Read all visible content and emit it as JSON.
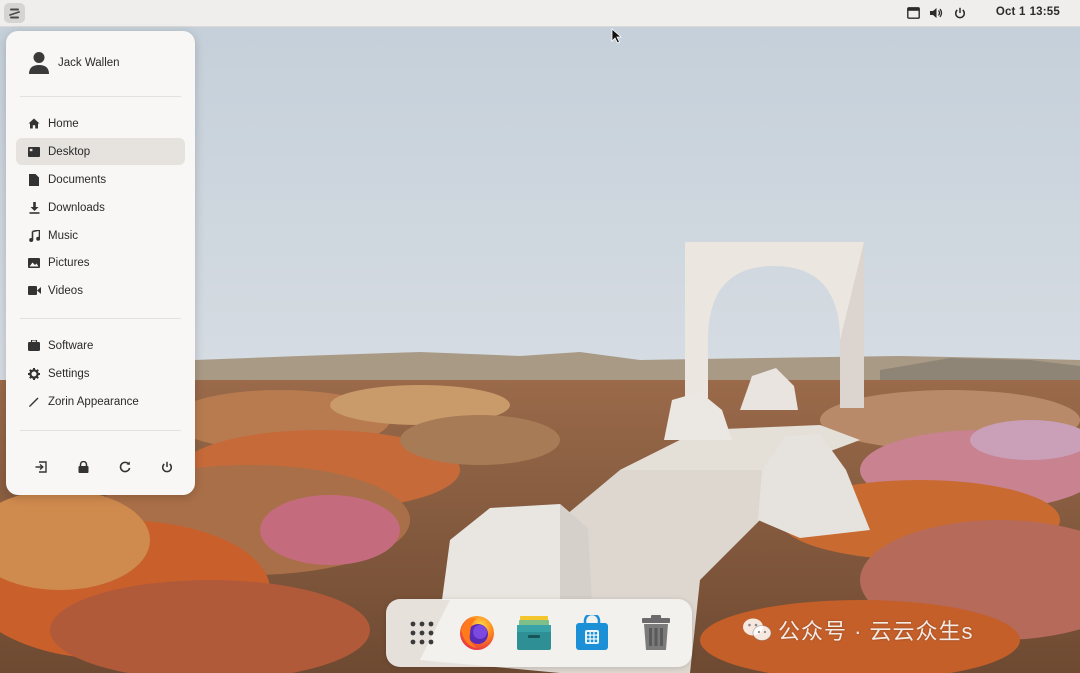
{
  "top_bar": {
    "menu_button_icon": "zorin-logo-icon",
    "tray_icons": [
      "display-icon",
      "volume-icon",
      "power-icon"
    ],
    "date": "Oct 1",
    "time": "13:55"
  },
  "places_menu": {
    "user_name": "Jack Wallen",
    "places": [
      {
        "label": "Home",
        "icon": "home-icon"
      },
      {
        "label": "Desktop",
        "icon": "desktop-icon",
        "active": true
      },
      {
        "label": "Documents",
        "icon": "document-icon"
      },
      {
        "label": "Downloads",
        "icon": "download-icon"
      },
      {
        "label": "Music",
        "icon": "music-icon"
      },
      {
        "label": "Pictures",
        "icon": "picture-icon"
      },
      {
        "label": "Videos",
        "icon": "video-icon"
      }
    ],
    "apps": [
      {
        "label": "Software",
        "icon": "briefcase-icon"
      },
      {
        "label": "Settings",
        "icon": "gear-icon"
      },
      {
        "label": "Zorin Appearance",
        "icon": "appearance-icon"
      }
    ],
    "system_actions": [
      "logout-icon",
      "lock-icon",
      "restart-icon",
      "power-icon"
    ]
  },
  "dock": {
    "items": [
      "app-grid-icon",
      "firefox-icon",
      "files-icon",
      "software-store-icon",
      "trash-icon"
    ]
  },
  "watermark": {
    "text": "公众号 · 云云众生s"
  },
  "colors": {
    "panel_bg": "#f8f7f5",
    "active_item_bg": "#e6e3de",
    "topbar_bg": "#efeeec",
    "firefox_orange": "#f57a14",
    "files_teal": "#2e8f94",
    "store_blue": "#1b90d6"
  }
}
